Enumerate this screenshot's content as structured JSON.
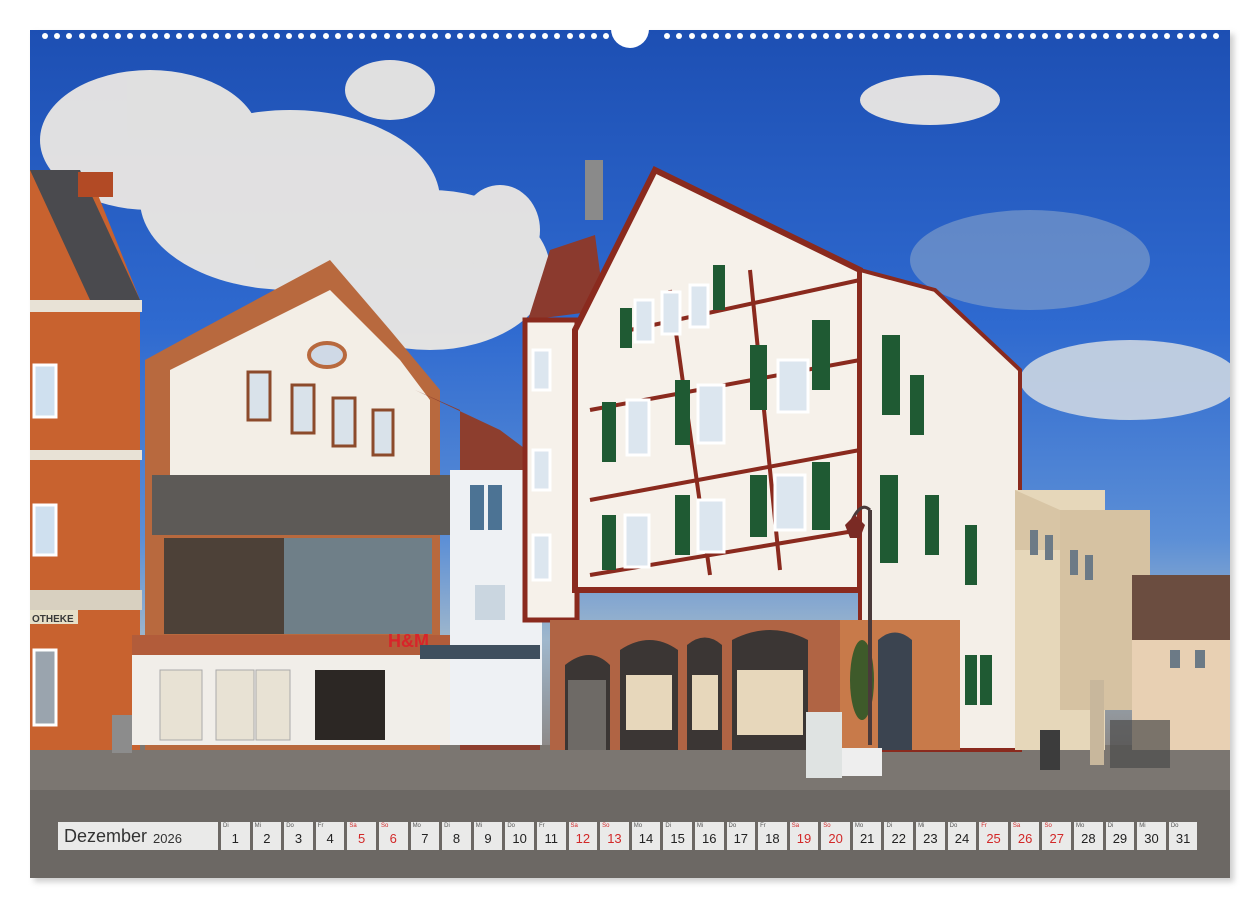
{
  "calendar": {
    "month": "Dezember",
    "year": "2026",
    "days": [
      {
        "wd": "Di",
        "d": "1",
        "type": "work"
      },
      {
        "wd": "Mi",
        "d": "2",
        "type": "work"
      },
      {
        "wd": "Do",
        "d": "3",
        "type": "work"
      },
      {
        "wd": "Fr",
        "d": "4",
        "type": "work"
      },
      {
        "wd": "Sa",
        "d": "5",
        "type": "sat"
      },
      {
        "wd": "So",
        "d": "6",
        "type": "sun"
      },
      {
        "wd": "Mo",
        "d": "7",
        "type": "work"
      },
      {
        "wd": "Di",
        "d": "8",
        "type": "work"
      },
      {
        "wd": "Mi",
        "d": "9",
        "type": "work"
      },
      {
        "wd": "Do",
        "d": "10",
        "type": "work"
      },
      {
        "wd": "Fr",
        "d": "11",
        "type": "work"
      },
      {
        "wd": "Sa",
        "d": "12",
        "type": "sat"
      },
      {
        "wd": "So",
        "d": "13",
        "type": "sun"
      },
      {
        "wd": "Mo",
        "d": "14",
        "type": "work"
      },
      {
        "wd": "Di",
        "d": "15",
        "type": "work"
      },
      {
        "wd": "Mi",
        "d": "16",
        "type": "work"
      },
      {
        "wd": "Do",
        "d": "17",
        "type": "work"
      },
      {
        "wd": "Fr",
        "d": "18",
        "type": "work"
      },
      {
        "wd": "Sa",
        "d": "19",
        "type": "sat"
      },
      {
        "wd": "So",
        "d": "20",
        "type": "sun"
      },
      {
        "wd": "Mo",
        "d": "21",
        "type": "work"
      },
      {
        "wd": "Di",
        "d": "22",
        "type": "work"
      },
      {
        "wd": "Mi",
        "d": "23",
        "type": "work"
      },
      {
        "wd": "Do",
        "d": "24",
        "type": "work"
      },
      {
        "wd": "Fr",
        "d": "25",
        "type": "hol"
      },
      {
        "wd": "Sa",
        "d": "26",
        "type": "sat"
      },
      {
        "wd": "So",
        "d": "27",
        "type": "sun"
      },
      {
        "wd": "Mo",
        "d": "28",
        "type": "work"
      },
      {
        "wd": "Di",
        "d": "29",
        "type": "work"
      },
      {
        "wd": "Mi",
        "d": "30",
        "type": "work"
      },
      {
        "wd": "Do",
        "d": "31",
        "type": "work"
      }
    ]
  },
  "photo": {
    "signs": {
      "store": "H&M",
      "left_fragment": "OTHEKE"
    }
  },
  "colors": {
    "sky_top": "#1d4fb3",
    "timber": "#8a2a1e",
    "shutter": "#1f5a33",
    "brick": "#c8622f",
    "sale_red": "#d22828"
  }
}
